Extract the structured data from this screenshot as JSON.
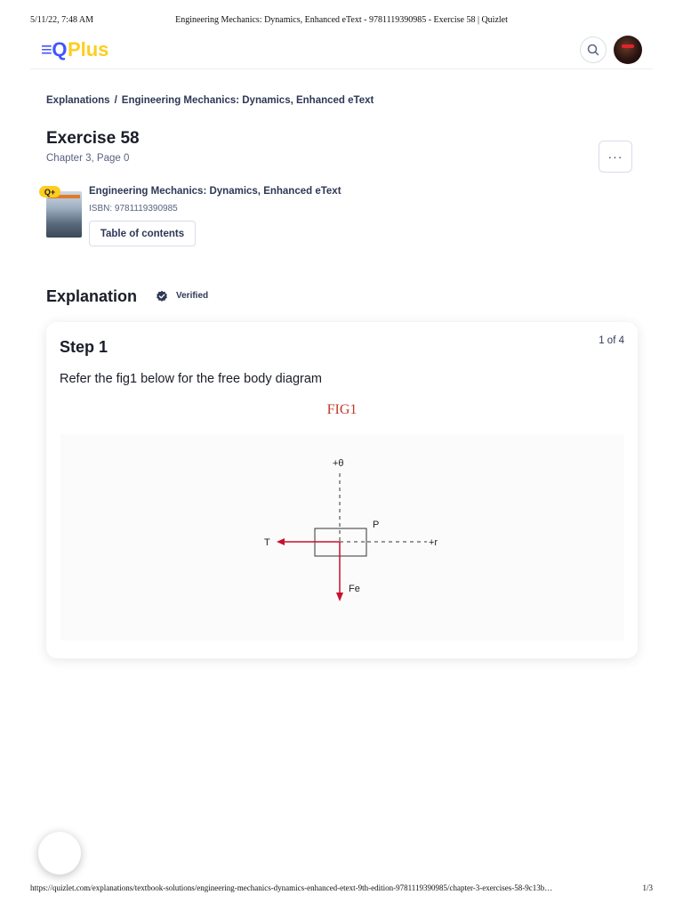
{
  "print_header": {
    "date": "5/11/22, 7:48 AM",
    "title": "Engineering Mechanics: Dynamics, Enhanced eText - 9781119390985 - Exercise 58 | Quizlet"
  },
  "topbar": {
    "logo_prefix": "≡Q",
    "logo_plus": "Plus"
  },
  "breadcrumb": {
    "items": [
      "Explanations",
      "Engineering Mechanics: Dynamics, Enhanced eText"
    ],
    "separator": "/"
  },
  "exercise": {
    "title": "Exercise 58",
    "subtitle": "Chapter 3, Page 0",
    "more_label": "···"
  },
  "book": {
    "badge": "Q+",
    "title": "Engineering Mechanics: Dynamics, Enhanced eText",
    "isbn": "ISBN: 9781119390985",
    "toc_label": "Table of contents"
  },
  "explanation": {
    "heading": "Explanation",
    "verified_label": "Verified"
  },
  "step": {
    "title": "Step 1",
    "count": "1 of 4",
    "text": "Refer the fig1 below for the free body diagram",
    "figure_title": "FIG1",
    "figure_labels": {
      "theta": "+θ",
      "p": "P",
      "t": "T",
      "r": "+r",
      "fe": "Fe"
    }
  },
  "print_footer": {
    "url": "https://quizlet.com/explanations/textbook-solutions/engineering-mechanics-dynamics-enhanced-etext-9th-edition-9781119390985/chapter-3-exercises-58-9c13b…",
    "page": "1/3"
  },
  "colors": {
    "brand_blue": "#4255ff",
    "brand_yellow": "#ffcd1f",
    "arrow_red": "#c8102e",
    "fig_title": "#c0392b"
  }
}
